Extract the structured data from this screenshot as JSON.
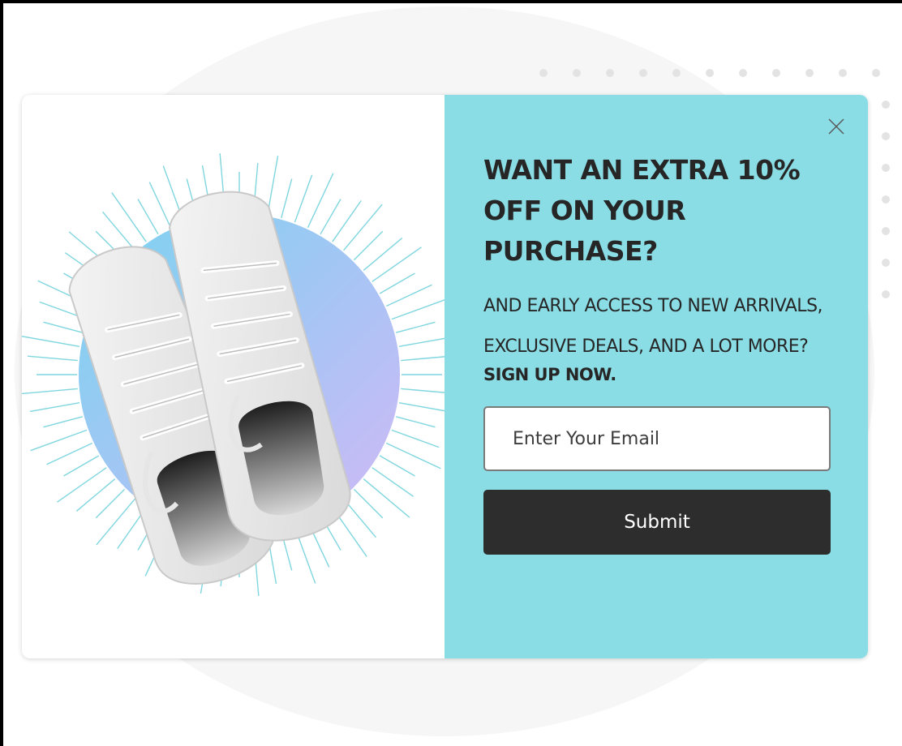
{
  "popup": {
    "headline": "WANT AN EXTRA 10% OFF ON YOUR PURCHASE?",
    "subtext": "AND EARLY ACCESS TO NEW ARRIVALS, EXCLUSIVE DEALS, AND A LOT MORE?",
    "cta": "SIGN UP NOW.",
    "email_placeholder": "Enter Your Email",
    "submit_label": "Submit",
    "close_icon": "close-icon",
    "image_icon": "sneakers-image"
  },
  "colors": {
    "panel_accent": "#8adde5",
    "button_bg": "#2d2d2d",
    "text_dark": "#262626",
    "burst_rays": "#7fd6df",
    "circle_gradient_start": "#7ad3ef",
    "circle_gradient_end": "#cbb4f4"
  }
}
